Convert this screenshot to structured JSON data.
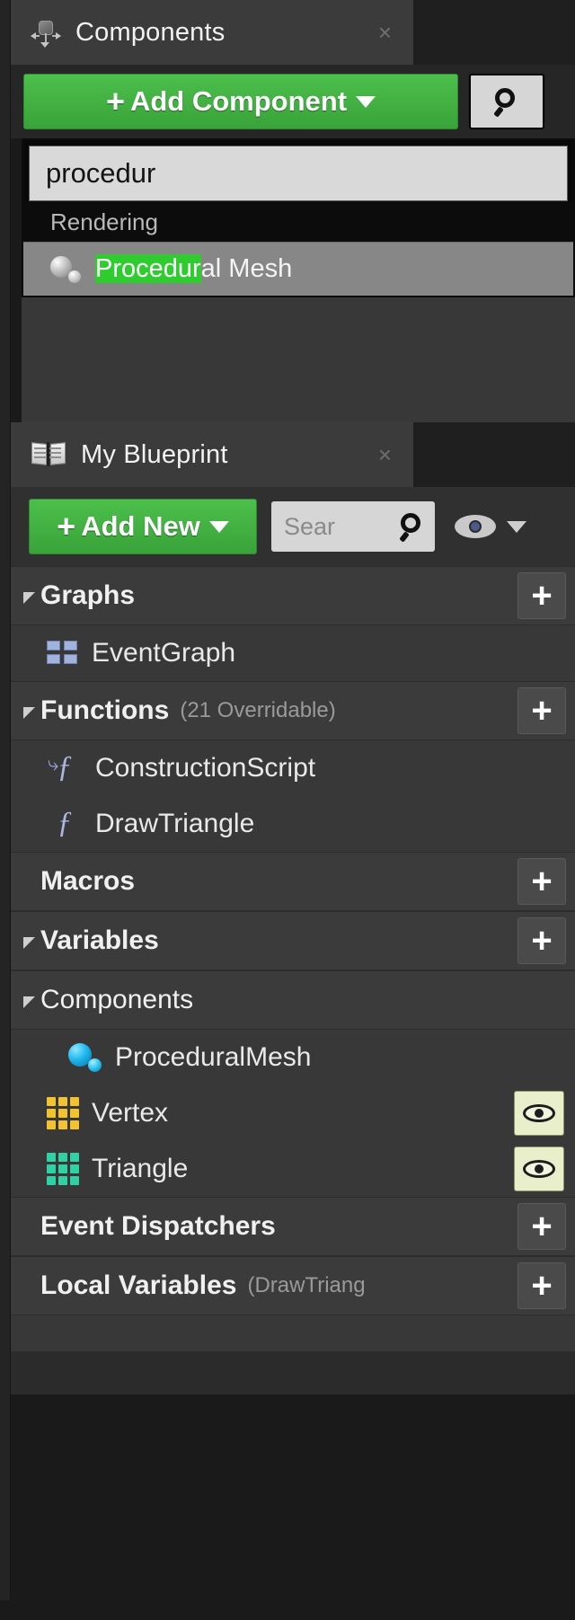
{
  "components_panel": {
    "tab": {
      "icon": "components-gizmo-icon",
      "title": "Components",
      "close": "×"
    },
    "toolbar": {
      "add_component_label": "Add Component",
      "add_component_plus": "+",
      "search_icon": "search-icon"
    },
    "dropdown": {
      "search_value": "procedur",
      "category": "Rendering",
      "item": {
        "icon": "sphere-mesh-icon",
        "match_text": "Procedur",
        "rest_text": "al Mesh",
        "full_text": "Procedural Mesh"
      }
    }
  },
  "myblueprint_panel": {
    "tab": {
      "icon": "book-icon",
      "title": "My Blueprint",
      "close": "×"
    },
    "toolbar": {
      "add_new_label": "Add New",
      "add_new_plus": "+",
      "search_placeholder": "Sear",
      "search_icon": "search-icon",
      "visibility_icon": "eye-icon",
      "visibility_caret": "chevron-down-icon"
    },
    "sections": {
      "graphs": {
        "title": "Graphs",
        "add": "+"
      },
      "functions": {
        "title": "Functions",
        "note": "(21 Overridable)",
        "add": "+"
      },
      "macros": {
        "title": "Macros",
        "add": "+"
      },
      "variables": {
        "title": "Variables",
        "add": "+"
      },
      "components": {
        "title": "Components"
      },
      "event_dispatchers": {
        "title": "Event Dispatchers",
        "add": "+"
      },
      "local_variables": {
        "title": "Local Variables",
        "note": "(DrawTriang",
        "add": "+"
      }
    },
    "items": {
      "eventgraph": {
        "label": "EventGraph",
        "icon": "event-graph-icon"
      },
      "construction_script": {
        "label": "ConstructionScript",
        "icon": "construction-script-icon"
      },
      "draw_triangle": {
        "label": "DrawTriangle",
        "icon": "function-icon"
      },
      "procedural_mesh": {
        "label": "ProceduralMesh",
        "icon": "procedural-mesh-component-icon"
      },
      "vertex": {
        "label": "Vertex",
        "icon": "array-grid-icon",
        "color": "#f2c230",
        "eye": "eye-icon"
      },
      "triangle": {
        "label": "Triangle",
        "icon": "array-grid-icon",
        "color": "#2fd1a5",
        "eye": "eye-icon"
      }
    }
  },
  "colors": {
    "accent_green": "#3fae3f",
    "highlight_green": "#2ecc2e",
    "panel_bg": "#383838",
    "tab_bg": "#3b3b3b",
    "vertex_yellow": "#f2c230",
    "triangle_teal": "#2fd1a5",
    "mesh_blue": "#1fb8ee"
  }
}
